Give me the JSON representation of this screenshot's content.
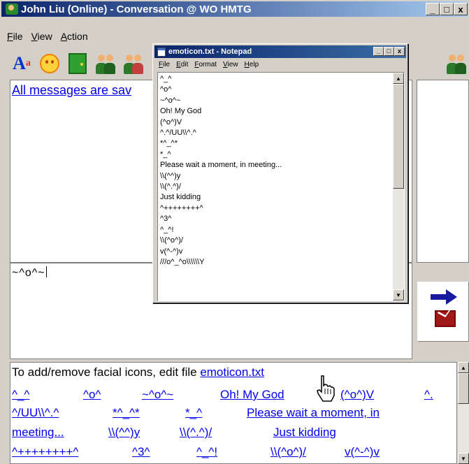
{
  "window": {
    "title": "John Liu (Online) - Conversation @ WO HMTG",
    "controls": {
      "minimize": "_",
      "maximize": "□",
      "close": "x"
    }
  },
  "menu": [
    "File",
    "View",
    "Action"
  ],
  "toolbar": {
    "font_label": "A",
    "font_sup": "a",
    "icons": [
      "font-icon",
      "smiley-icon",
      "door-exit-icon",
      "contacts-icon",
      "invite-contacts-icon",
      "contact-profile-icon"
    ]
  },
  "chat": {
    "message": "All messages are sav"
  },
  "input": {
    "value": "~^o^~"
  },
  "send": {
    "icon": "send-arrow-icon"
  },
  "emoticons": {
    "header_text": "To add/remove facial icons, edit file ",
    "header_link": "emoticon.txt",
    "items": [
      "^_^",
      "^o^",
      "~^o^~",
      "Oh! My God",
      "(^o^)V",
      "^.",
      "^/UU\\\\^.^",
      "*^_^*",
      "*_^",
      "Please wait a moment, in",
      "meeting...",
      "\\\\(^^)y",
      "\\\\(^.^)/",
      "Just kidding",
      "^++++++++^",
      "^3^",
      "^_^!",
      "\\\\(^o^)/",
      "v(^-^)v"
    ]
  },
  "notepad": {
    "title": "emoticon.txt - Notepad",
    "menu": [
      "File",
      "Edit",
      "Format",
      "View",
      "Help"
    ],
    "lines": [
      "^_^",
      "^o^",
      "~^o^~",
      "Oh! My God",
      "(^o^)V",
      "^.^/UU\\\\^.^",
      "*^_^*",
      "*_^",
      "Please wait a moment, in meeting...",
      "\\\\(^^)y",
      "\\\\(^.^)/",
      "Just kidding",
      "^++++++++^",
      "^3^",
      "^_^!",
      "\\\\(^o^)/",
      "v(^-^)v",
      "///o^_^o\\\\\\\\\\\\Y"
    ]
  }
}
